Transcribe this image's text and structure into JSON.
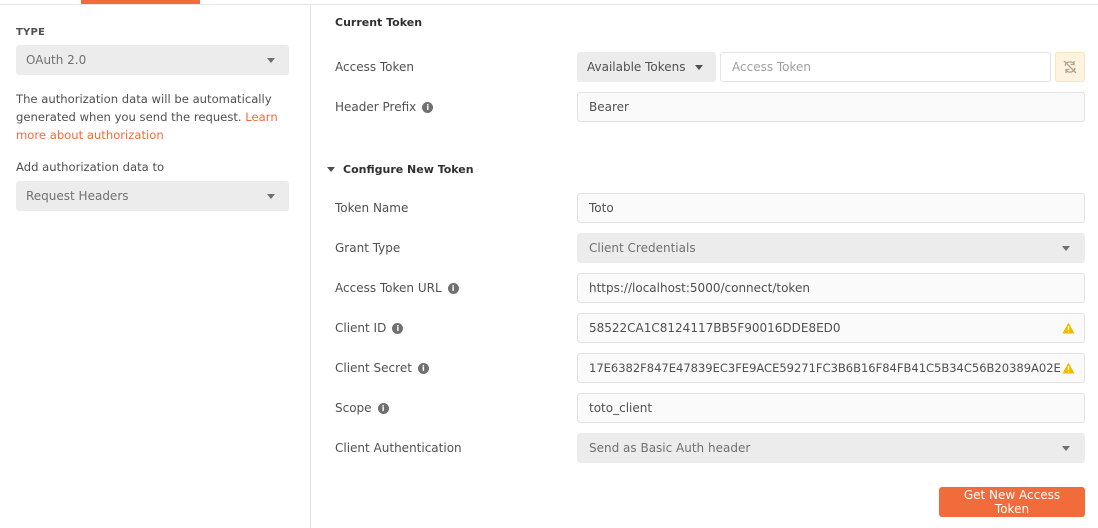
{
  "auth_sidebar": {
    "type_label": "TYPE",
    "type_value": "OAuth 2.0",
    "description": "The authorization data will be automatically generated when you send the request.",
    "learn_more_link": "Learn more about authorization",
    "add_to_label": "Add authorization data to",
    "add_to_value": "Request Headers"
  },
  "current_token": {
    "section_title": "Current Token",
    "access_token_label": "Access Token",
    "available_tokens_label": "Available Tokens",
    "access_token_placeholder": "Access Token",
    "header_prefix_label": "Header Prefix",
    "header_prefix_value": "Bearer"
  },
  "configure_token": {
    "section_title": "Configure New Token",
    "fields": {
      "token_name": {
        "label": "Token Name",
        "value": "Toto"
      },
      "grant_type": {
        "label": "Grant Type",
        "value": "Client Credentials"
      },
      "access_token_url": {
        "label": "Access Token URL",
        "value": "https://localhost:5000/connect/token"
      },
      "client_id": {
        "label": "Client ID",
        "value": "58522CA1C8124117BB5F90016DDE8ED0"
      },
      "client_secret": {
        "label": "Client Secret",
        "value": "17E6382F847E47839EC3FE9ACE59271FC3B6B16F84FB41C5B34C56B20389A02E"
      },
      "scope": {
        "label": "Scope",
        "value": "toto_client"
      },
      "client_authentication": {
        "label": "Client Authentication",
        "value": "Send as Basic Auth header"
      }
    },
    "get_token_button": "Get New Access Token"
  },
  "icons": {
    "info": "info-icon",
    "warning": "warning-icon",
    "sync": "sync-icon",
    "dropdown": "chevron-down-icon"
  },
  "colors": {
    "accent": "#f26b3a",
    "warning": "#f5b800",
    "select_bg": "#ececec"
  }
}
